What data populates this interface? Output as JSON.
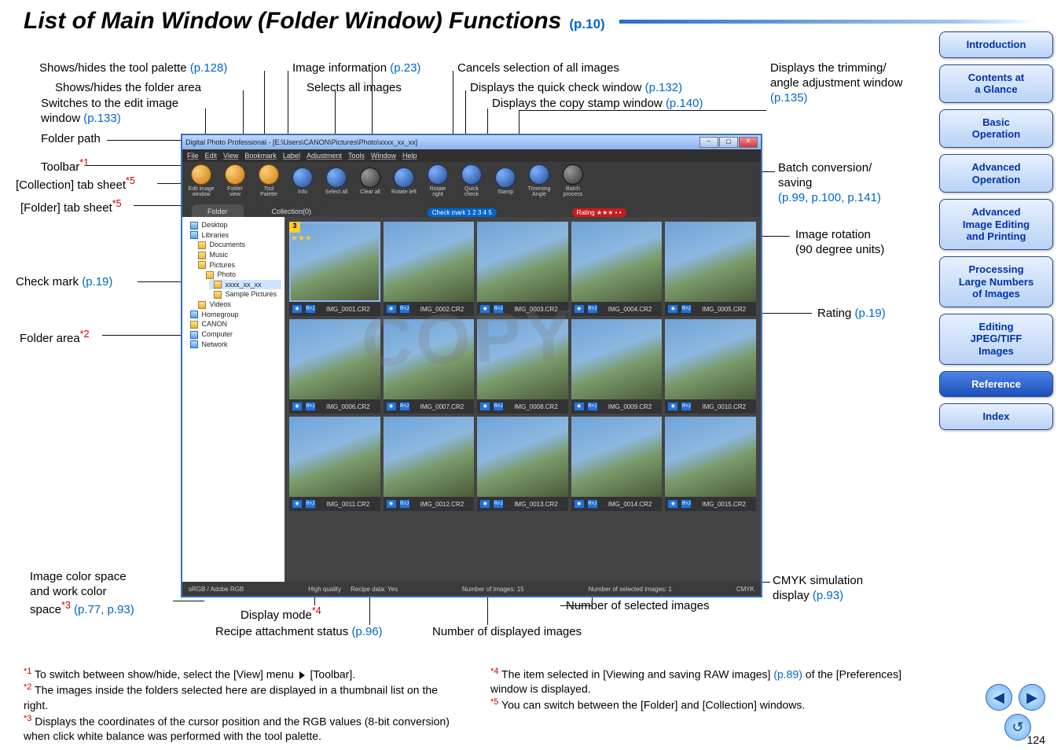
{
  "page": {
    "title": "List of Main Window (Folder Window) Functions",
    "pageRef": "(p.10)",
    "pageNumber": "124"
  },
  "sidenav": [
    {
      "label": "Introduction",
      "active": false
    },
    {
      "label": "Contents at\na Glance",
      "active": false
    },
    {
      "label": "Basic\nOperation",
      "active": false
    },
    {
      "label": "Advanced\nOperation",
      "active": false
    },
    {
      "label": "Advanced\nImage Editing\nand Printing",
      "active": false
    },
    {
      "label": "Processing\nLarge Numbers\nof Images",
      "active": false
    },
    {
      "label": "Editing\nJPEG/TIFF\nImages",
      "active": false
    },
    {
      "label": "Reference",
      "active": true
    },
    {
      "label": "Index",
      "active": false
    }
  ],
  "labels": {
    "showToolPalette": "Shows/hides the tool palette",
    "showToolPaletteRef": "(p.128)",
    "imageInfo": "Image information",
    "imageInfoRef": "(p.23)",
    "cancelSel": "Cancels selection of all images",
    "trimWindow": "Displays the trimming/\nangle adjustment window",
    "trimWindowRef": "(p.135)",
    "showFolderArea": "Shows/hides the folder area",
    "selectAll": "Selects all images",
    "quickCheck": "Displays the quick check window",
    "quickCheckRef": "(p.132)",
    "editWindow": "Switches to the edit image\nwindow",
    "editWindowRef": "(p.133)",
    "copyStamp": "Displays the copy stamp window",
    "copyStampRef": "(p.140)",
    "folderPath": "Folder path",
    "toolbar": "Toolbar",
    "toolbarSup": "*1",
    "collectionTab": "[Collection] tab sheet",
    "collectionTabSup": "*5",
    "folderTab": "[Folder] tab sheet",
    "folderTabSup": "*5",
    "checkMark": "Check mark",
    "checkMarkRef": "(p.19)",
    "folderArea": "Folder area",
    "folderAreaSup": "*2",
    "batch": "Batch conversion/\nsaving",
    "batchRef": "(p.99, p.100, p.141)",
    "rotation": "Image rotation\n(90 degree units)",
    "rating": "Rating",
    "ratingRef": "(p.19)",
    "cmyk": "CMYK simulation\ndisplay",
    "cmykRef": "(p.93)",
    "numSel": "Number of selected images",
    "numDisp": "Number of displayed images",
    "recipeStatus": "Recipe attachment status",
    "recipeStatusRef": "(p.96)",
    "displayMode": "Display mode",
    "displayModeSup": "*4",
    "colorSpace": "Image color space\nand work color\nspace",
    "colorSpaceSup": "*3",
    "colorSpaceRef": "(p.77, p.93)"
  },
  "shot": {
    "windowTitle": "Digital Photo Professional - [E:\\Users\\CANON\\Pictures\\Photo\\xxxx_xx_xx]",
    "menu": [
      "File",
      "Edit",
      "View",
      "Bookmark",
      "Label",
      "Adjustment",
      "Tools",
      "Window",
      "Help"
    ],
    "tools": [
      {
        "icon": "orange",
        "cap": "Edit image\nwindow"
      },
      {
        "icon": "orange",
        "cap": "Folder\nview"
      },
      {
        "icon": "orange",
        "cap": "Tool\nPalette"
      },
      {
        "icon": "blue",
        "cap": "Info"
      },
      {
        "icon": "blue",
        "cap": "Select all"
      },
      {
        "icon": "dark",
        "cap": "Clear all"
      },
      {
        "icon": "blue",
        "cap": "Rotate left"
      },
      {
        "icon": "blue",
        "cap": "Rotate right"
      },
      {
        "icon": "blue",
        "cap": "Quick\ncheck"
      },
      {
        "icon": "blue",
        "cap": "Stamp"
      },
      {
        "icon": "blue",
        "cap": "Trimming\nAngle"
      },
      {
        "icon": "dark",
        "cap": "Batch\nprocess"
      }
    ],
    "tabs": {
      "folder": "Folder",
      "collection": "Collection(0)"
    },
    "checkmarkChip": "Check mark  1 2 3 4 5",
    "ratingChip": "Rating ★★★ • •",
    "tree": [
      {
        "t": "Desktop",
        "cls": "ico-lib"
      },
      {
        "t": "Libraries",
        "cls": "ico-lib",
        "sub": [
          {
            "t": "Documents",
            "cls": "ico-folder"
          },
          {
            "t": "Music",
            "cls": "ico-folder"
          },
          {
            "t": "Pictures",
            "cls": "ico-folder",
            "sub": [
              {
                "t": "Photo",
                "cls": "ico-folder",
                "sub": [
                  {
                    "t": "xxxx_xx_xx",
                    "cls": "ico-folder",
                    "sel": true
                  },
                  {
                    "t": "Sample Pictures",
                    "cls": "ico-folder"
                  }
                ]
              }
            ]
          },
          {
            "t": "Videos",
            "cls": "ico-folder"
          }
        ]
      },
      {
        "t": "Homegroup",
        "cls": "ico-lib"
      },
      {
        "t": "CANON",
        "cls": "ico-folder"
      },
      {
        "t": "Computer",
        "cls": "ico-lib"
      },
      {
        "t": "Network",
        "cls": "ico-lib"
      }
    ],
    "thumbs": [
      "IMG_0001.CR2",
      "IMG_0002.CR2",
      "IMG_0003.CR2",
      "IMG_0004.CR2",
      "IMG_0005.CR2",
      "IMG_0006.CR2",
      "IMG_0007.CR2",
      "IMG_0008.CR2",
      "IMG_0009.CR2",
      "IMG_0010.CR2",
      "IMG_0011.CR2",
      "IMG_0012.CR2",
      "IMG_0013.CR2",
      "IMG_0014.CR2",
      "IMG_0015.CR2"
    ],
    "status": {
      "colorSpace": "sRGB / Adobe RGB",
      "quality": "High quality",
      "recipe": "Recipe data: Yes",
      "numImages": "Number of images: 15",
      "numSelected": "Number of selected images: 1",
      "cmyk": "CMYK"
    }
  },
  "footnotes": {
    "n1a": "To switch between show/hide, select the [View] menu",
    "n1b": "[Toolbar].",
    "n2": "The images inside the folders selected here are displayed in a thumbnail list on the right.",
    "n3": "Displays the coordinates of the cursor position and the RGB values (8-bit conversion) when click white balance was performed with the tool palette.",
    "n4a": "The item selected in [Viewing and saving RAW images]",
    "n4ref": "(p.89)",
    "n4b": "of the [Preferences] window is displayed.",
    "n5": "You can switch between the [Folder] and [Collection] windows."
  },
  "watermark": "COPY"
}
